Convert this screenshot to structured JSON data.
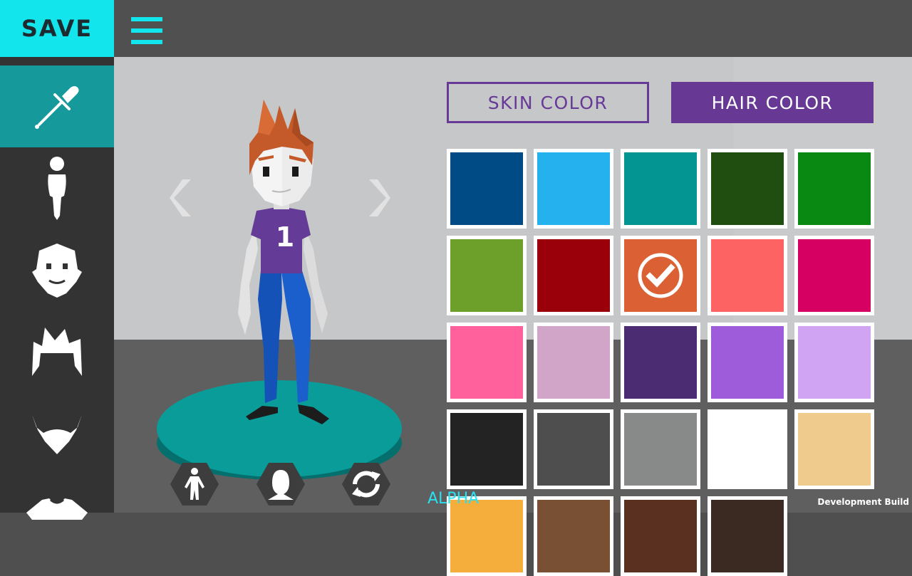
{
  "header": {
    "save_label": "SAVE"
  },
  "sidebar": {
    "items": [
      {
        "name": "dropper-icon",
        "active": true
      },
      {
        "name": "body-icon",
        "active": false
      },
      {
        "name": "face-icon",
        "active": false
      },
      {
        "name": "hair-icon",
        "active": false
      },
      {
        "name": "beard-icon",
        "active": false
      },
      {
        "name": "shirt-icon",
        "active": false
      }
    ]
  },
  "tabs": {
    "skin_label": "SKIN COLOR",
    "hair_label": "HAIR COLOR",
    "selected": "hair"
  },
  "character": {
    "jersey_number": "1"
  },
  "swatches": {
    "selected_index": 7,
    "colors": [
      "#004a85",
      "#25b1ee",
      "#029591",
      "#204e10",
      "#098812",
      "#6ca02a",
      "#9a0009",
      "#db6033",
      "#fe6363",
      "#d60062",
      "#fe619b",
      "#d0a5c8",
      "#4b2b72",
      "#9f5cda",
      "#d0a4f2",
      "#232323",
      "#4e4e4e",
      "#888989",
      "#ffffff",
      "#efcc8d",
      "#f5ad3c",
      "#7a5035",
      "#5a3020",
      "#3a2a22"
    ]
  },
  "footer": {
    "alpha": "ALPHA",
    "dev_build": "Development Build"
  },
  "colors": {
    "accent": "#13e5ed",
    "purple": "#673995",
    "teal": "#15999a"
  }
}
